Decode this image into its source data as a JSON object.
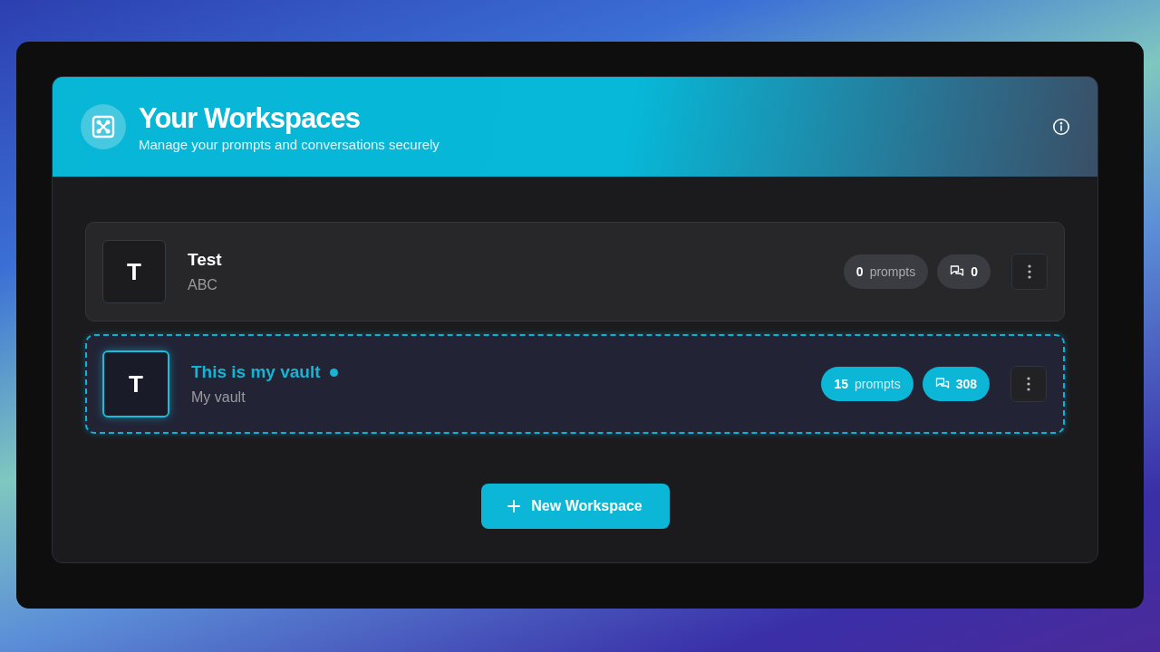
{
  "header": {
    "title": "Your Workspaces",
    "subtitle": "Manage your prompts and conversations securely"
  },
  "workspaces": [
    {
      "initial": "T",
      "name": "Test",
      "description": "ABC",
      "prompts_count": "0",
      "prompts_label": "prompts",
      "conversations": "0",
      "selected": false
    },
    {
      "initial": "T",
      "name": "This is my vault",
      "description": "My vault",
      "prompts_count": "15",
      "prompts_label": "prompts",
      "conversations": "308",
      "selected": true
    }
  ],
  "new_button": {
    "label": "New Workspace"
  }
}
